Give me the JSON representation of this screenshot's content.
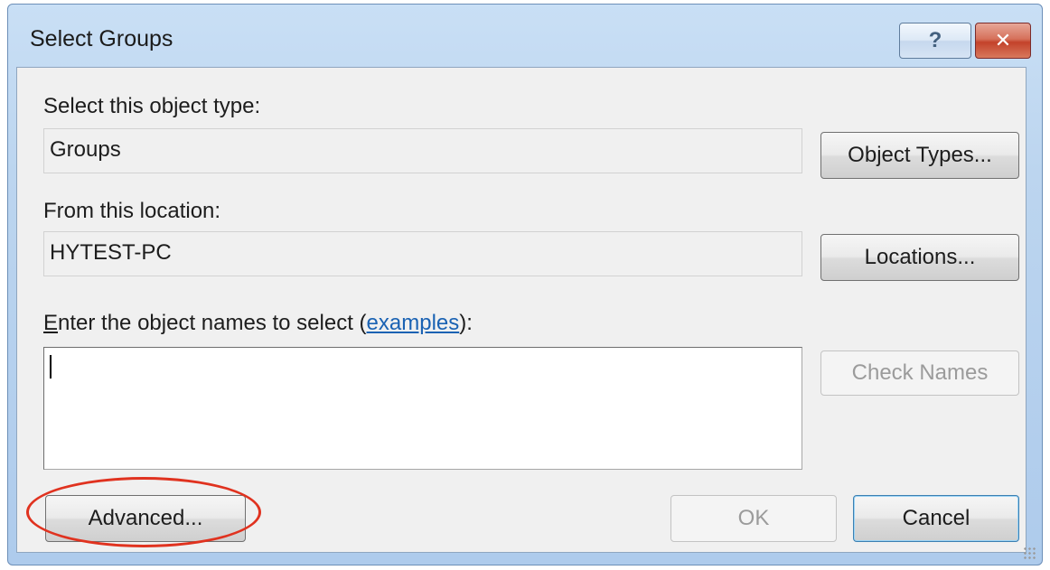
{
  "window": {
    "title": "Select Groups",
    "help_glyph": "?",
    "close_glyph": "✕"
  },
  "object_type": {
    "label": "Select this object type:",
    "value": "Groups",
    "button": "Object Types..."
  },
  "location": {
    "label": "From this location:",
    "value": "HYTEST-PC",
    "button": "Locations..."
  },
  "names": {
    "label_first": "E",
    "label_rest": "nter the object names to select (",
    "link": "examples",
    "label_end": "):",
    "value": "",
    "check_button": "Check Names"
  },
  "footer": {
    "advanced_button": "Advanced...",
    "ok_button": "OK",
    "cancel_button": "Cancel"
  },
  "colors": {
    "annotation_ring": "#e0321f",
    "link": "#1a62b3"
  }
}
